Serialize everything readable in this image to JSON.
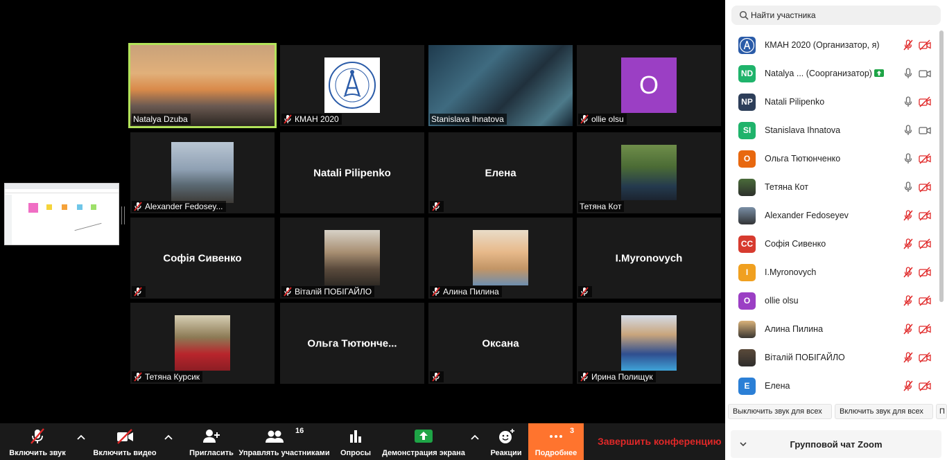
{
  "colors": {
    "active_speaker": "#b3e35a",
    "more_button": "#ff742e",
    "end_meeting": "#e02828",
    "share_green": "#1ea446",
    "mute_red": "#e02828"
  },
  "video_tiles": [
    {
      "name": "Natalya  Dzuba",
      "active": true,
      "muted": false,
      "video": "photo"
    },
    {
      "name": "КМАН 2020",
      "active": false,
      "muted": true,
      "video": "logo"
    },
    {
      "name": "Stanislava Ihnatova",
      "active": false,
      "muted": false,
      "video": "photo"
    },
    {
      "name": "ollie olsu",
      "active": false,
      "muted": true,
      "video": "avatar-letter",
      "letter": "O"
    },
    {
      "name": "Alexander Fedosey...",
      "active": false,
      "muted": true,
      "video": "photo"
    },
    {
      "name": "",
      "center_name": "Natali Pilipenko",
      "active": false,
      "muted": false,
      "video": "none"
    },
    {
      "name": "",
      "center_name": "Елена",
      "active": false,
      "muted": true,
      "video": "none"
    },
    {
      "name": "Тетяна Кот",
      "active": false,
      "muted": false,
      "video": "photo"
    },
    {
      "name": "",
      "center_name": "Софія Сивенко",
      "active": false,
      "muted": true,
      "video": "none"
    },
    {
      "name": "Віталій ПОБІГАЙЛО",
      "active": false,
      "muted": true,
      "video": "photo"
    },
    {
      "name": "Алина Пилина",
      "active": false,
      "muted": true,
      "video": "photo"
    },
    {
      "name": "",
      "center_name": "I.Myronovych",
      "active": false,
      "muted": true,
      "video": "none"
    },
    {
      "name": "Тетяна Курсик",
      "active": false,
      "muted": true,
      "video": "photo"
    },
    {
      "name": "",
      "center_name": "Ольга  Тютюнче...",
      "active": false,
      "muted": false,
      "video": "none"
    },
    {
      "name": "",
      "center_name": "Оксана",
      "active": false,
      "muted": true,
      "video": "none"
    },
    {
      "name": "Ирина Полищук",
      "active": false,
      "muted": true,
      "video": "photo"
    }
  ],
  "logo_text": "КИЇВСЬКА МАЛА АКАДЕМІЯ НАУК",
  "toolbar": {
    "audio": "Включить звук",
    "video": "Включить видео",
    "invite": "Пригласить",
    "participants": "Управлять участниками",
    "participants_count": "16",
    "polls": "Опросы",
    "share": "Демонстрация экрана",
    "reactions": "Реакции",
    "more": "Подробнее",
    "more_count": "3",
    "end": "Завершить конференцию"
  },
  "panel": {
    "search_placeholder": "Найти участника",
    "participants": [
      {
        "initials": "",
        "avatar": "logo",
        "color": "#2a5ba8",
        "name": "КМАН 2020 (Организатор, я)",
        "mic": "muted",
        "cam": "off"
      },
      {
        "initials": "ND",
        "avatar": "letters",
        "color": "#1fb36b",
        "name": "Natalya  ...  (Соорганизатор)",
        "share": true,
        "mic": "on",
        "cam": "on"
      },
      {
        "initials": "NP",
        "avatar": "letters",
        "color": "#2d3e59",
        "name": "Natali Pilipenko",
        "mic": "on",
        "cam": "off"
      },
      {
        "initials": "SI",
        "avatar": "letters",
        "color": "#1fb36b",
        "name": "Stanislava Ihnatova",
        "mic": "on",
        "cam": "on"
      },
      {
        "initials": "O",
        "avatar": "letters",
        "color": "#e8680f",
        "name": "Ольга Тютюнченко",
        "mic": "on",
        "cam": "off"
      },
      {
        "initials": "",
        "avatar": "photo",
        "color": "#4a6b3a",
        "name": "Тетяна Кот",
        "mic": "on",
        "cam": "off"
      },
      {
        "initials": "",
        "avatar": "photo",
        "color": "#7a8fa6",
        "name": "Alexander Fedoseyev",
        "mic": "muted",
        "cam": "off"
      },
      {
        "initials": "СС",
        "avatar": "letters",
        "color": "#d73b2f",
        "name": "Софія Сивенко",
        "mic": "muted",
        "cam": "off"
      },
      {
        "initials": "I",
        "avatar": "letters",
        "color": "#f0a020",
        "name": "I.Myronovych",
        "mic": "muted",
        "cam": "off"
      },
      {
        "initials": "O",
        "avatar": "letters",
        "color": "#9b3fc4",
        "name": "ollie olsu",
        "mic": "muted",
        "cam": "off"
      },
      {
        "initials": "",
        "avatar": "photo",
        "color": "#d9b27a",
        "name": "Алина Пилина",
        "mic": "muted",
        "cam": "off"
      },
      {
        "initials": "",
        "avatar": "photo",
        "color": "#5a4a3a",
        "name": "Віталій ПОБІГАЙЛО",
        "mic": "muted",
        "cam": "off"
      },
      {
        "initials": "E",
        "avatar": "letters",
        "color": "#2b7fd6",
        "name": "Елена",
        "mic": "muted",
        "cam": "off"
      }
    ],
    "mute_all": "Выключить звук для всех",
    "unmute_all": "Включить звук для всех",
    "more_cut": "П",
    "chat_title": "Групповой чат Zoom"
  }
}
